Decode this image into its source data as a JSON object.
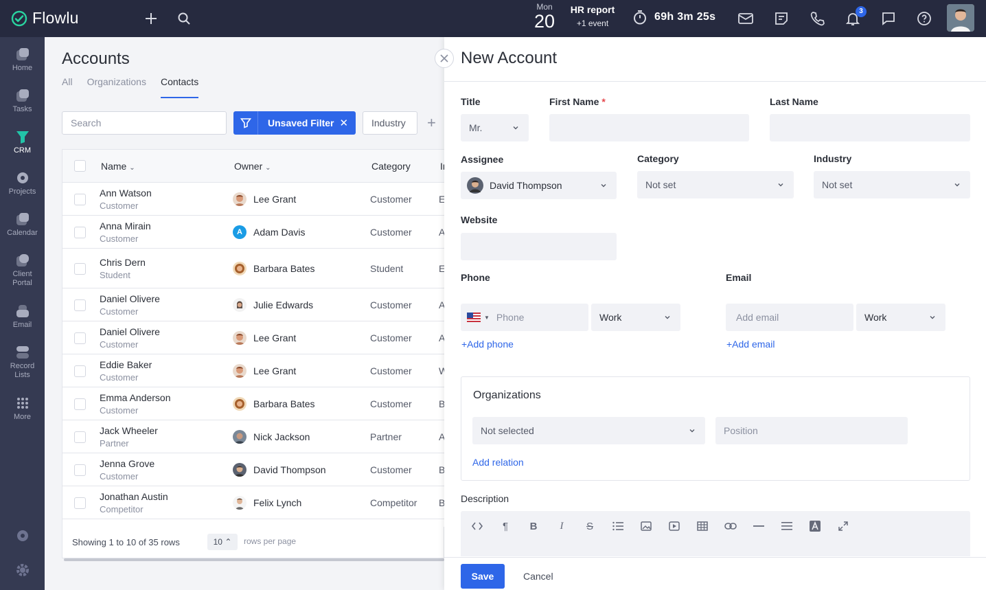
{
  "app": {
    "name": "Flowlu"
  },
  "topbar": {
    "date_day": "Mon",
    "date_num": "20",
    "event_title": "HR report",
    "event_sub": "+1 event",
    "timer": "69h 3m 25s",
    "notifications_count": "3"
  },
  "sidebar": {
    "items": [
      {
        "label": "Home",
        "icon": "home-icon"
      },
      {
        "label": "Tasks",
        "icon": "tasks-icon"
      },
      {
        "label": "CRM",
        "icon": "crm-icon",
        "active": true
      },
      {
        "label": "Projects",
        "icon": "projects-icon"
      },
      {
        "label": "Calendar",
        "icon": "calendar-icon"
      },
      {
        "label": "Client Portal",
        "icon": "client-portal-icon"
      },
      {
        "label": "Email",
        "icon": "email-icon"
      },
      {
        "label": "Record Lists",
        "icon": "record-lists-icon"
      },
      {
        "label": "More",
        "icon": "more-icon"
      }
    ]
  },
  "accounts": {
    "title": "Accounts",
    "tabs": [
      "All",
      "Organizations",
      "Contacts"
    ],
    "active_tab": "Contacts",
    "search_placeholder": "Search",
    "filter_label": "Unsaved Filter",
    "industry_label": "Industry",
    "columns": [
      "Name",
      "Owner",
      "Category",
      "Ir"
    ],
    "rows": [
      {
        "name": "Ann Watson",
        "sub": "Customer",
        "owner": "Lee Grant",
        "category": "Customer",
        "ind": "E"
      },
      {
        "name": "Anna Mirain",
        "sub": "Customer",
        "owner": "Adam Davis",
        "category": "Customer",
        "ind": "A"
      },
      {
        "name": "Chris Dern",
        "sub": "Student",
        "owner": "Barbara Bates",
        "category": "Student",
        "ind": "E"
      },
      {
        "name": "Daniel Olivere",
        "sub": "Customer",
        "owner": "Julie Edwards",
        "category": "Customer",
        "ind": "A"
      },
      {
        "name": "Daniel Olivere",
        "sub": "Customer",
        "owner": "Lee Grant",
        "category": "Customer",
        "ind": "A"
      },
      {
        "name": "Eddie Baker",
        "sub": "Customer",
        "owner": "Lee Grant",
        "category": "Customer",
        "ind": "W"
      },
      {
        "name": "Emma Anderson",
        "sub": "Customer",
        "owner": "Barbara Bates",
        "category": "Customer",
        "ind": "B"
      },
      {
        "name": "Jack Wheeler",
        "sub": "Partner",
        "owner": "Nick Jackson",
        "category": "Partner",
        "ind": "A"
      },
      {
        "name": "Jenna Grove",
        "sub": "Customer",
        "owner": "David Thompson",
        "category": "Customer",
        "ind": "B"
      },
      {
        "name": "Jonathan Austin",
        "sub": "Competitor",
        "owner": "Felix Lynch",
        "category": "Competitor",
        "ind": "B"
      }
    ],
    "adam_initial": "A",
    "showing": "Showing 1 to 10 of 35 rows",
    "per_page": "10",
    "rows_per_page": "rows per page"
  },
  "new_account": {
    "title": "New Account",
    "title_label": "Title",
    "title_value": "Mr.",
    "first_name_label": "First Name",
    "required_mark": "*",
    "last_name_label": "Last Name",
    "assignee_label": "Assignee",
    "assignee_value": "David Thompson",
    "category_label": "Category",
    "category_value": "Not set",
    "industry_label": "Industry",
    "industry_value": "Not set",
    "website_label": "Website",
    "phone_label": "Phone",
    "phone_placeholder": "Phone",
    "phone_type": "Work",
    "add_phone": "+Add phone",
    "email_label": "Email",
    "email_placeholder": "Add email",
    "email_type": "Work",
    "add_email": "+Add email",
    "organizations_title": "Organizations",
    "org_select": "Not selected",
    "position_placeholder": "Position",
    "add_relation": "Add relation",
    "description_label": "Description",
    "save": "Save",
    "cancel": "Cancel"
  },
  "colors": {
    "accent": "#2e66e8",
    "topbar": "#262a3f",
    "sidebar": "#353a52",
    "crm": "#22c4a8"
  }
}
